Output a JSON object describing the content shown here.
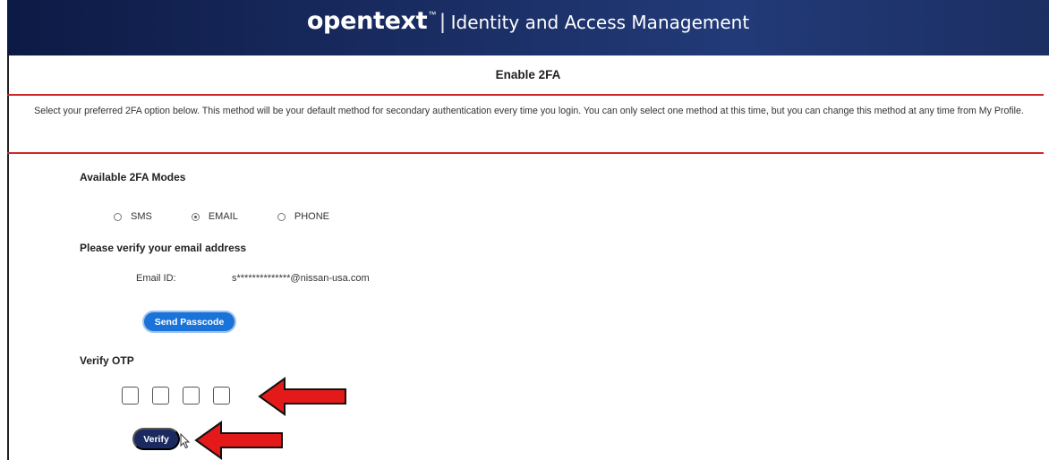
{
  "header": {
    "logo": "opentext",
    "trademark": "™",
    "separator": "|",
    "product": "Identity and Access Management"
  },
  "page": {
    "title": "Enable 2FA",
    "instructions": "Select your preferred 2FA option below. This method will be your default method for secondary authentication every time you login. You can only select one method at this time, but you can change this method at any time from My Profile."
  },
  "modes": {
    "title": "Available 2FA Modes",
    "options": [
      {
        "label": "SMS",
        "checked": false
      },
      {
        "label": "EMAIL",
        "checked": true
      },
      {
        "label": "PHONE",
        "checked": false
      }
    ]
  },
  "verify_email": {
    "title": "Please verify your email address",
    "label": "Email ID:",
    "value": "s**************@nissan-usa.com",
    "send_button": "Send Passcode"
  },
  "otp": {
    "title": "Verify OTP",
    "box_count": 4,
    "verify_button": "Verify"
  },
  "colors": {
    "header_dark": "#0d1a45",
    "accent_red": "#cc2a2a",
    "send_button": "#1a73d9",
    "verify_button": "#1a2a60",
    "annotation_arrow": "#e41a1a"
  },
  "icons": [
    "radio-icon",
    "arrow-annotation-icon",
    "mouse-pointer-icon"
  ]
}
